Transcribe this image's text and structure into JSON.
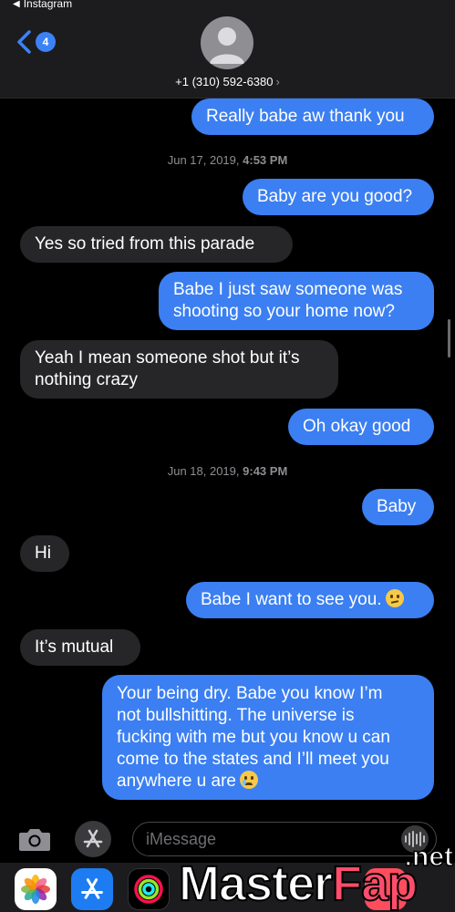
{
  "status": {
    "back_app": "Instagram"
  },
  "header": {
    "back_badge": "4",
    "contact_number": "+1 (310) 592-6380",
    "contact_chevron": "›"
  },
  "conversation": {
    "m1": "Really babe aw thank you",
    "ts1_date": "Jun 17, 2019,",
    "ts1_time": "4:53 PM",
    "m2": "Baby are you good?",
    "m3": "Yes so tried from this parade",
    "m4_l1": "Babe I just saw someone was",
    "m4_l2": "shooting so your home now?",
    "m5_l1": "Yeah I mean someone shot but it’s",
    "m5_l2": "nothing crazy",
    "m6": "Oh okay good",
    "ts2_date": "Jun 18, 2019,",
    "ts2_time": "9:43 PM",
    "m7": "Baby",
    "m8": "Hi",
    "m9": "Babe I want to see you.",
    "m10": "It’s mutual",
    "m11_l1": "Your being dry. Babe you know I’m",
    "m11_l2": "not bullshitting. The universe is",
    "m11_l3": "fucking with me but you know u can",
    "m11_l4": "come to the states and I’ll meet you",
    "m11_l5": "anywhere u are"
  },
  "input_bar": {
    "placeholder": "iMessage"
  },
  "icons": {
    "back": "chevron-left-icon",
    "avatar": "person-icon",
    "camera": "camera-icon",
    "apps": "app-store-icon",
    "audio": "waveform-icon",
    "emoji1": "confused-face-icon",
    "emoji2": "crying-face-icon"
  },
  "watermark": {
    "main_1": "Master",
    "main_2": "Fap",
    "suffix": ".net"
  },
  "colors": {
    "sent_bubble": "#3b7ff2",
    "received_bubble": "#262628",
    "accent": "#3b82f6"
  }
}
